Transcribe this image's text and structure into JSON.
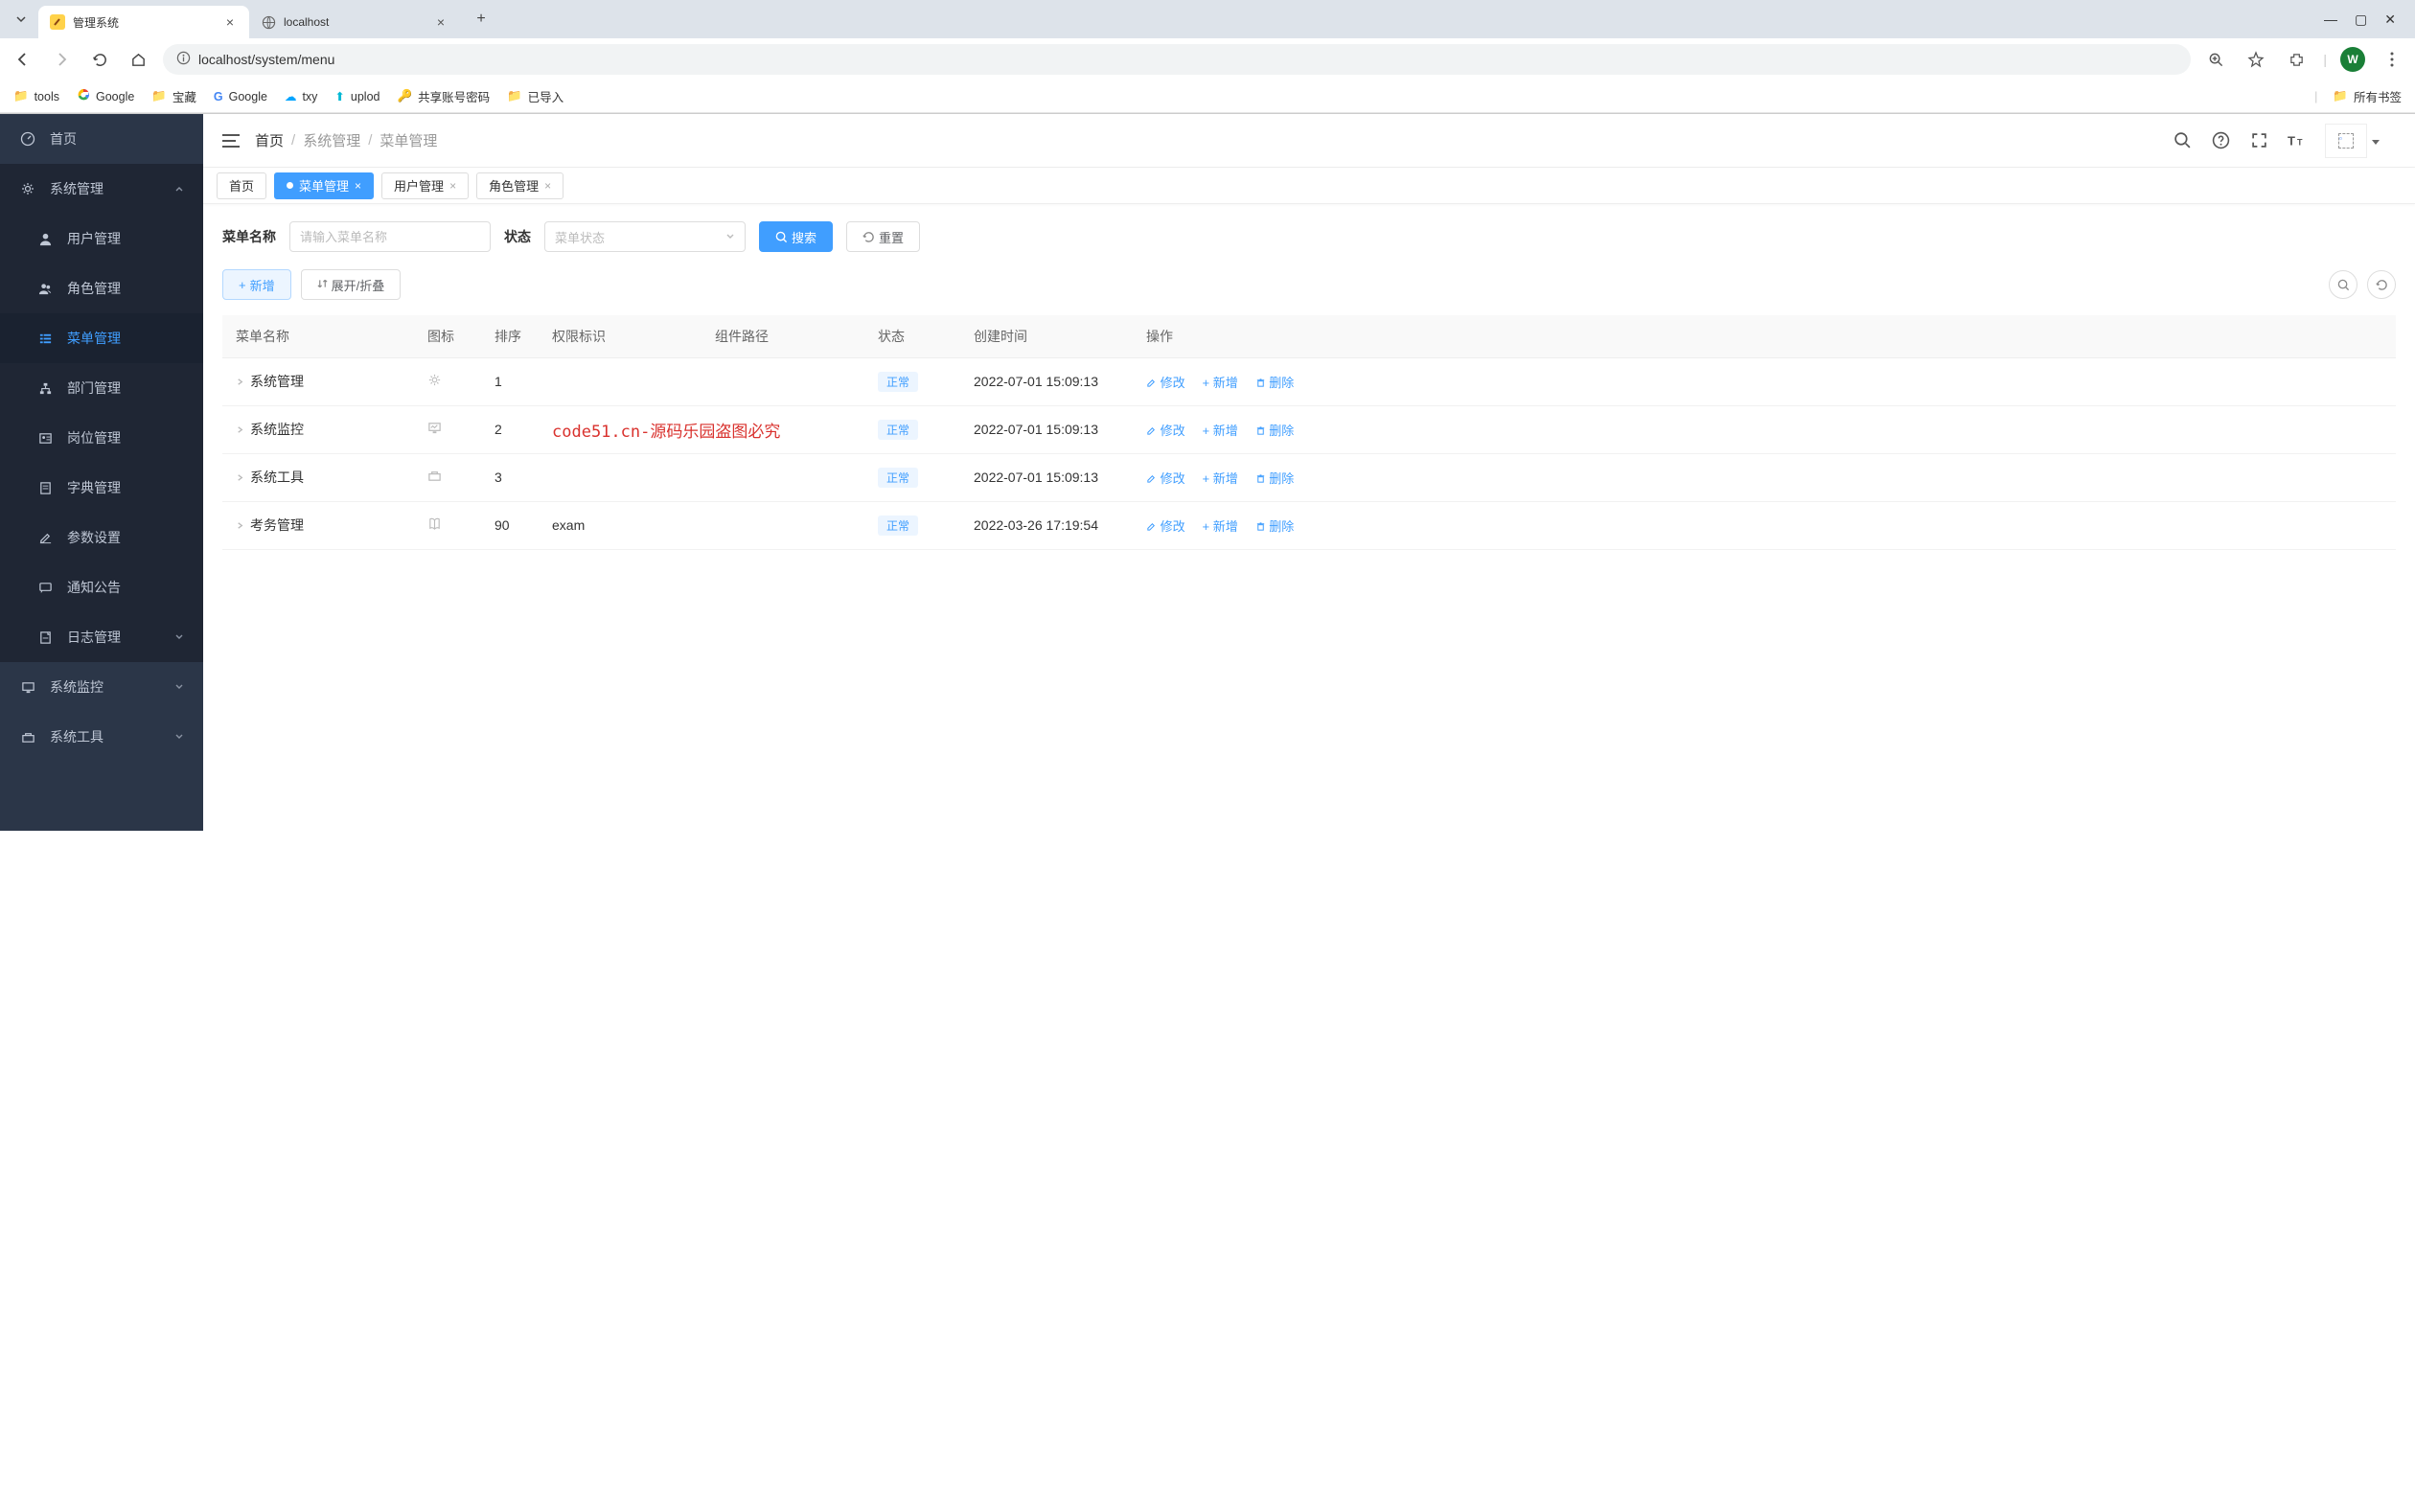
{
  "browser": {
    "tabs": [
      {
        "title": "管理系统",
        "active": true
      },
      {
        "title": "localhost",
        "active": false
      }
    ],
    "url_host": "localhost",
    "url_path": "/system/menu",
    "avatar_letter": "W",
    "bookmarks": [
      "tools",
      "Google",
      "宝藏",
      "Google",
      "txy",
      "uplod",
      "共享账号密码",
      "已导入"
    ],
    "all_bookmarks": "所有书签"
  },
  "sidebar": {
    "home": "首页",
    "section_system": "系统管理",
    "items": [
      "用户管理",
      "角色管理",
      "菜单管理",
      "部门管理",
      "岗位管理",
      "字典管理",
      "参数设置",
      "通知公告",
      "日志管理"
    ],
    "section_monitor": "系统监控",
    "section_tools": "系统工具"
  },
  "header": {
    "breadcrumb_root": "首页",
    "breadcrumb_1": "系统管理",
    "breadcrumb_2": "菜单管理"
  },
  "tabs": {
    "home": "首页",
    "t1": "菜单管理",
    "t2": "用户管理",
    "t3": "角色管理"
  },
  "search": {
    "name_label": "菜单名称",
    "name_placeholder": "请输入菜单名称",
    "status_label": "状态",
    "status_placeholder": "菜单状态",
    "search_btn": "搜索",
    "reset_btn": "重置"
  },
  "actions": {
    "add": "新增",
    "expand": "展开/折叠"
  },
  "table": {
    "headers": {
      "name": "菜单名称",
      "icon": "图标",
      "sort": "排序",
      "perm": "权限标识",
      "path": "组件路径",
      "status": "状态",
      "created": "创建时间",
      "ops": "操作"
    },
    "ops": {
      "edit": "修改",
      "add": "新增",
      "del": "删除"
    },
    "status_normal": "正常",
    "watermark": "code51.cn-源码乐园盗图必究",
    "rows": [
      {
        "name": "系统管理",
        "icon": "gear",
        "sort": "1",
        "perm": "",
        "path": "",
        "created": "2022-07-01 15:09:13"
      },
      {
        "name": "系统监控",
        "icon": "monitor",
        "sort": "2",
        "perm": "",
        "path": "",
        "created": "2022-07-01 15:09:13"
      },
      {
        "name": "系统工具",
        "icon": "toolbox",
        "sort": "3",
        "perm": "",
        "path": "",
        "created": "2022-07-01 15:09:13"
      },
      {
        "name": "考务管理",
        "icon": "book",
        "sort": "90",
        "perm": "exam",
        "path": "",
        "created": "2022-03-26 17:19:54"
      }
    ]
  }
}
